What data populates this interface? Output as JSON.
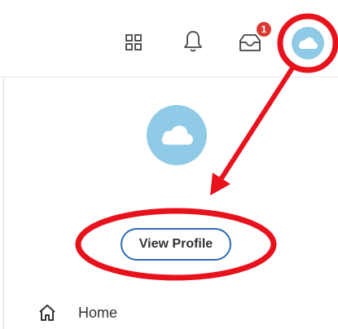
{
  "header": {
    "apps_icon": "apps-grid-icon",
    "bell_icon": "bell-icon",
    "inbox_icon": "inbox-icon",
    "inbox_badge": "1",
    "avatar_icon": "cloud-icon"
  },
  "profile": {
    "avatar_icon": "cloud-icon",
    "view_profile_label": "View Profile"
  },
  "menu": {
    "items": [
      {
        "label": "Home",
        "icon": "home-icon"
      }
    ]
  },
  "colors": {
    "avatar_bg": "#8fcbe6",
    "badge": "#d83a32",
    "button_border": "#2e6bb3",
    "annotation_red": "#e8121c"
  }
}
